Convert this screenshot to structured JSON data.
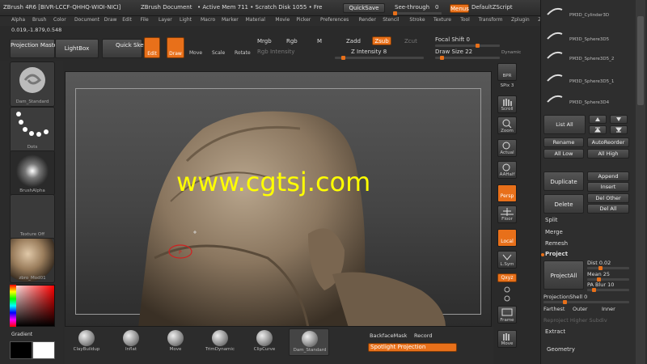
{
  "titlebar": {
    "app": "ZBrush 4R6 [BIVR-LCCF-QHHQ-WIOI-NICI]",
    "doc": "ZBrush Document",
    "mem": "• Active Mem 711 • Scratch Disk 1055 • Fre",
    "quicksave": "QuickSave",
    "seethrough": "See-through",
    "seethrough_val": "0",
    "menus": "Menus",
    "script": "DefaultZScript"
  },
  "menubar": [
    "Alpha",
    "Brush",
    "Color",
    "Document",
    "Draw",
    "Edit",
    "File",
    "Layer",
    "Light",
    "Macro",
    "Marker",
    "Material",
    "Movie",
    "Picker",
    "Preferences",
    "Render",
    "Stencil",
    "Stroke",
    "Texture",
    "Tool",
    "Transform",
    "Zplugin",
    "Zscript"
  ],
  "coords": "0.019,-1.879,0.548",
  "toolbar": {
    "projection_master": "Projection Master",
    "lightbox": "LightBox",
    "quick_sketch": "Quick Sketch",
    "edit": "Edit",
    "draw": "Draw",
    "move": "Move",
    "scale": "Scale",
    "rotate": "Rotate",
    "mrgb": "Mrgb",
    "rgb": "Rgb",
    "m": "M",
    "rgb_intensity": "Rgb Intensity",
    "zadd": "Zadd",
    "zsub": "Zsub",
    "zcut": "Zcut",
    "z_intensity": "Z Intensity",
    "z_intensity_val": "8",
    "focal_shift": "Focal Shift",
    "focal_shift_val": "0",
    "draw_size": "Draw Size",
    "draw_size_val": "22",
    "dynamic": "Dynamic"
  },
  "leftshelf": {
    "brush": "Dam_Standard",
    "stroke": "Dots",
    "alpha": "BrushAlpha",
    "texture": "Texture Off",
    "material": "zbro_Mod01",
    "gradient": "Gradient"
  },
  "watermark": "www.cgtsj.com",
  "rightnav": {
    "bpr": "BPR",
    "spix": "SPix",
    "spix_val": "3",
    "scroll": "Scroll",
    "zoom": "Zoom",
    "actual": "Actual",
    "aahalf": "AAHalf",
    "persp": "Persp",
    "floor": "Floor",
    "local": "Local",
    "lsym": "L.Sym",
    "xyz": "Qxyz",
    "frame": "Frame",
    "move": "Move"
  },
  "subtools": [
    "PM3D_Cylinder3D",
    "PM3D_Sphere3D5",
    "PM3D_Sphere3D5_2",
    "PM3D_Sphere3D5_1",
    "PM3D_Sphere3D4"
  ],
  "rightpanel": {
    "list_all": "List All",
    "rename": "Rename",
    "autoreorder": "AutoReorder",
    "all_low": "All Low",
    "all_high": "All High",
    "duplicate": "Duplicate",
    "append": "Append",
    "insert": "Insert",
    "delete": "Delete",
    "del_other": "Del Other",
    "del_all": "Del All",
    "split": "Split",
    "merge": "Merge",
    "remesh": "Remesh",
    "project": "Project",
    "projectall": "ProjectAll",
    "dist": "Dist",
    "dist_val": "0.02",
    "mean": "Mean",
    "mean_val": "25",
    "pa_blur": "PA Blur",
    "pa_blur_val": "10",
    "projectionshell": "ProjectionShell",
    "projectionshell_val": "0",
    "farthest": "Farthest",
    "outer": "Outer",
    "inner": "Inner",
    "reproject": "Reproject Higher Subdiv",
    "extract": "Extract",
    "geometry": "Geometry"
  },
  "bottomshelf": {
    "brushes": [
      "ClayBuildup",
      "Inflat",
      "Move",
      "TrimDynamic",
      "ClipCurve",
      "Dam_Standard"
    ],
    "backface": "BackfaceMask",
    "record": "Record",
    "spotlight": "Spotlight Projection"
  },
  "colors": {
    "accent": "#e8701a",
    "watermark": "#ffff00"
  }
}
